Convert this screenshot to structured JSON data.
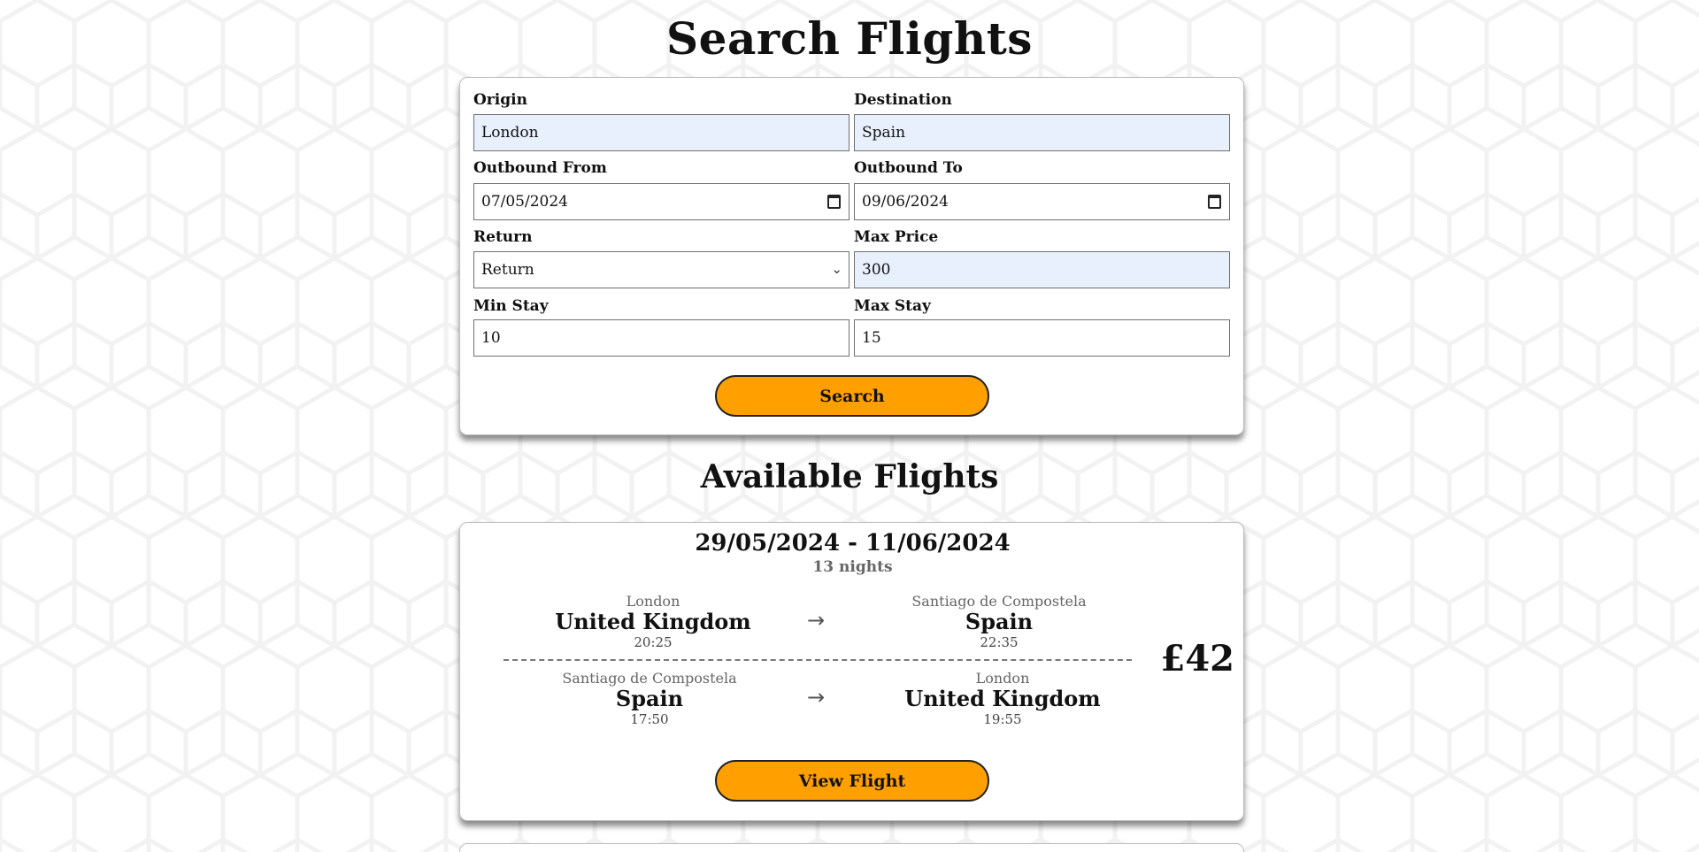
{
  "page": {
    "title": "Search Flights",
    "results_title": "Available Flights"
  },
  "search": {
    "origin_label": "Origin",
    "origin_value": "London",
    "destination_label": "Destination",
    "destination_value": "Spain",
    "outbound_from_label": "Outbound From",
    "outbound_from_value": "07/05/2024",
    "outbound_to_label": "Outbound To",
    "outbound_to_value": "09/06/2024",
    "return_label": "Return",
    "return_value": "Return",
    "max_price_label": "Max Price",
    "max_price_value": "300",
    "min_stay_label": "Min Stay",
    "min_stay_value": "10",
    "max_stay_label": "Max Stay",
    "max_stay_value": "15",
    "search_button": "Search"
  },
  "flights": [
    {
      "dates": "29/05/2024 - 11/06/2024",
      "nights": "13  nights",
      "price": "£42",
      "outbound": {
        "from_city": "London",
        "from_country": "United Kingdom",
        "from_time": "20:25",
        "to_city": "Santiago de Compostela",
        "to_country": "Spain",
        "to_time": "22:35"
      },
      "inbound": {
        "from_city": "Santiago de Compostela",
        "from_country": "Spain",
        "from_time": "17:50",
        "to_city": "London",
        "to_country": "United Kingdom",
        "to_time": "19:55"
      },
      "view_button": "View Flight"
    }
  ],
  "colors": {
    "accent": "#ffa000",
    "autofill": "#e8f0fe",
    "background": "#ffffff"
  },
  "icons": {
    "date_picker": "calendar-icon",
    "select": "chevron-down-icon",
    "direction": "arrow-right-icon"
  }
}
